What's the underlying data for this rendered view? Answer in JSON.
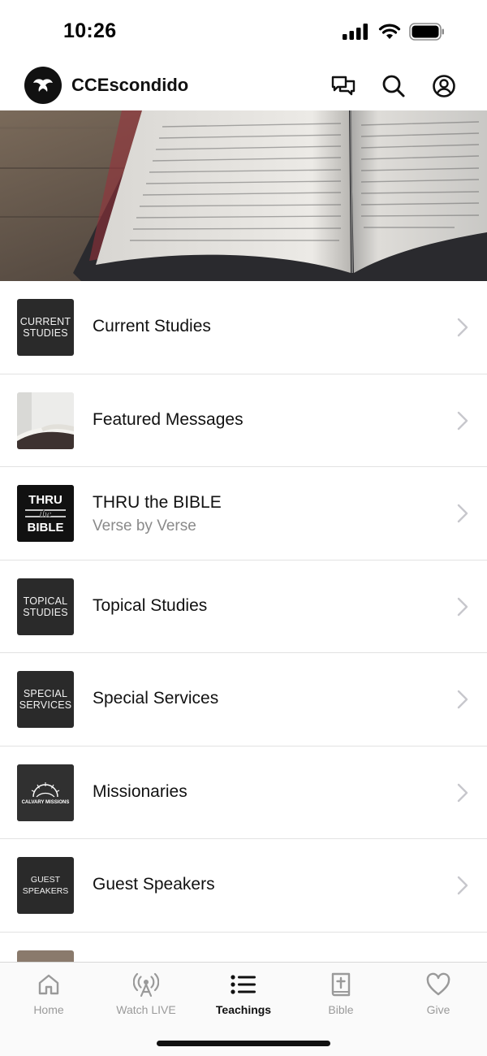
{
  "status_bar": {
    "time": "10:26",
    "icons": [
      "signal-icon",
      "wifi-icon",
      "battery-icon"
    ]
  },
  "header": {
    "title": "CCEscondido",
    "logo_icon": "dove-logo-icon",
    "actions": [
      "chat-icon",
      "search-icon",
      "account-icon"
    ]
  },
  "hero": {
    "image": "open-bible-photo"
  },
  "teachings": [
    {
      "thumb_text": "CURRENT\nSTUDIES",
      "title": "Current Studies",
      "subtitle": ""
    },
    {
      "thumb_text": "",
      "title": "Featured Messages",
      "subtitle": ""
    },
    {
      "thumb_text": "THRU the BIBLE",
      "title": "THRU the BIBLE",
      "subtitle": "Verse by Verse"
    },
    {
      "thumb_text": "TOPICAL\nSTUDIES",
      "title": "Topical Studies",
      "subtitle": ""
    },
    {
      "thumb_text": "SPECIAL\nSERVICES",
      "title": "Special Services",
      "subtitle": ""
    },
    {
      "thumb_text": "CALVARY MISSIONS",
      "title": "Missionaries",
      "subtitle": ""
    },
    {
      "thumb_text": "GUEST\nSPEAKERS",
      "title": "Guest Speakers",
      "subtitle": ""
    }
  ],
  "tabs": [
    {
      "label": "Home",
      "icon": "home-icon",
      "active": false
    },
    {
      "label": "Watch LIVE",
      "icon": "broadcast-icon",
      "active": false
    },
    {
      "label": "Teachings",
      "icon": "list-icon",
      "active": true
    },
    {
      "label": "Bible",
      "icon": "bible-icon",
      "active": false
    },
    {
      "label": "Give",
      "icon": "heart-icon",
      "active": false
    }
  ],
  "colors": {
    "text": "#111111",
    "muted": "#8a8a8a",
    "tab_inactive": "#9a9a9a",
    "divider": "#e2e2e2",
    "thumb_bg": "#2a2a2a"
  }
}
